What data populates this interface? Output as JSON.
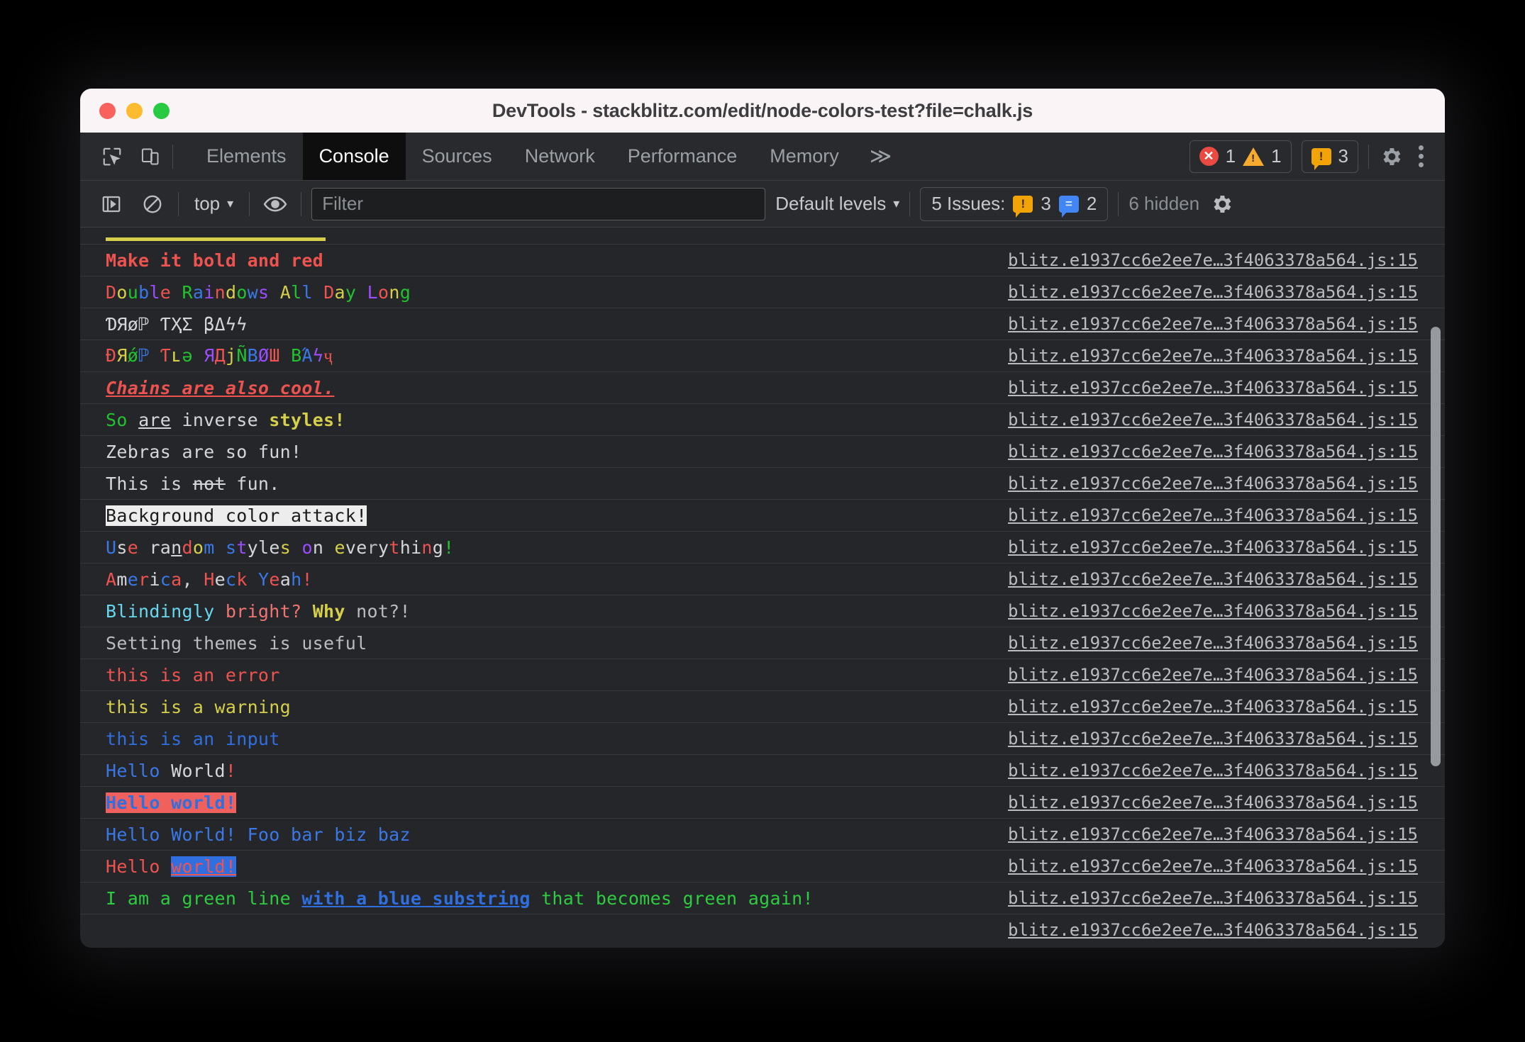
{
  "window": {
    "title": "DevTools - stackblitz.com/edit/node-colors-test?file=chalk.js",
    "traffic_lights": [
      "close-button",
      "minimize-button",
      "maximize-button"
    ]
  },
  "tabbar": {
    "inspect_icon": "inspect-element-icon",
    "device_icon": "device-toolbar-icon",
    "tabs": [
      {
        "label": "Elements",
        "active": false
      },
      {
        "label": "Console",
        "active": true
      },
      {
        "label": "Sources",
        "active": false
      },
      {
        "label": "Network",
        "active": false
      },
      {
        "label": "Performance",
        "active": false
      },
      {
        "label": "Memory",
        "active": false
      }
    ],
    "more_tabs_label": "≫",
    "error_count": "1",
    "warning_count": "1",
    "issue_count": "3",
    "issue_glyph": "!",
    "settings_icon": "gear-icon",
    "menu_icon": "kebab-menu-icon"
  },
  "console_toolbar": {
    "sidebar_icon": "console-sidebar-icon",
    "clear_icon": "clear-console-icon",
    "context": "top",
    "context_caret": "▾",
    "eye_icon": "live-expression-icon",
    "filter_placeholder": "Filter",
    "filter_value": "",
    "levels_label": "Default levels",
    "levels_caret": "▾",
    "issues_label": "5 Issues:",
    "issues_warning_count": "3",
    "issues_info_count": "2",
    "hidden_label": "6 hidden",
    "settings_icon": "console-settings-icon"
  },
  "colors": {
    "red": "#ef5350",
    "salmon": "#f07571",
    "yellow": "#d6cf4a",
    "green": "#22c32e",
    "bright_green": "#2ecc40",
    "blue": "#3b78e7",
    "bright_blue": "#2f6fe0",
    "magenta": "#9b4dff",
    "cyan": "#67d8ef",
    "white": "#d4d6d9",
    "grey": "#b9bcc0",
    "bg_white": "#ededed",
    "bg_red": "#f0605c",
    "bg_blue": "#2f6fe0"
  },
  "source_link": "blitz.e1937cc6e2ee7e…3f4063378a564.js:15",
  "messages": [
    {
      "name": "message-make-it-bold-and-red",
      "text": "Make it bold and red",
      "runs": [
        {
          "t": "Make it bold and red",
          "c": "#ef5350",
          "cls": "b"
        }
      ]
    },
    {
      "name": "message-double-raindows",
      "text": "Double Raindows All Day Long",
      "runs": [
        {
          "t": "D",
          "c": "#ef5350"
        },
        {
          "t": "o",
          "c": "#d6cf4a"
        },
        {
          "t": "u",
          "c": "#22c32e"
        },
        {
          "t": "b",
          "c": "#3b78e7"
        },
        {
          "t": "l",
          "c": "#9b4dff"
        },
        {
          "t": "e",
          "c": "#ef5350"
        },
        {
          "t": " ",
          "c": "#d4d6d9"
        },
        {
          "t": "R",
          "c": "#22c32e"
        },
        {
          "t": "a",
          "c": "#3b78e7"
        },
        {
          "t": "i",
          "c": "#9b4dff"
        },
        {
          "t": "n",
          "c": "#ef5350"
        },
        {
          "t": "d",
          "c": "#d6cf4a"
        },
        {
          "t": "o",
          "c": "#22c32e"
        },
        {
          "t": "w",
          "c": "#3b78e7"
        },
        {
          "t": "s",
          "c": "#9b4dff"
        },
        {
          "t": " ",
          "c": "#d4d6d9"
        },
        {
          "t": "A",
          "c": "#d6cf4a"
        },
        {
          "t": "l",
          "c": "#22c32e"
        },
        {
          "t": "l",
          "c": "#3b78e7"
        },
        {
          "t": " ",
          "c": "#d4d6d9"
        },
        {
          "t": "D",
          "c": "#ef5350"
        },
        {
          "t": "a",
          "c": "#d6cf4a"
        },
        {
          "t": "y",
          "c": "#22c32e"
        },
        {
          "t": " ",
          "c": "#d4d6d9"
        },
        {
          "t": "L",
          "c": "#9b4dff"
        },
        {
          "t": "o",
          "c": "#ef5350"
        },
        {
          "t": "n",
          "c": "#d6cf4a"
        },
        {
          "t": "g",
          "c": "#22c32e"
        }
      ]
    },
    {
      "name": "message-drop-the-bass",
      "text": "ƊЯøℙ ƬҲΣ βΔϟϟ",
      "runs": [
        {
          "t": "ƊЯøℙ ƬҲΣ βΔϟϟ",
          "c": "#d4d6d9"
        }
      ]
    },
    {
      "name": "message-drop-the-rainbow-bass",
      "text": "ÐЯǿℙ Ƭʟə ЯДјÑΒØШ ΒΆϟҷ",
      "runs": [
        {
          "t": "Ð",
          "c": "#ef5350"
        },
        {
          "t": "Я",
          "c": "#d6cf4a"
        },
        {
          "t": "ǿ",
          "c": "#22c32e"
        },
        {
          "t": "ℙ",
          "c": "#3b78e7"
        },
        {
          "t": " ",
          "c": "#d4d6d9"
        },
        {
          "t": "Ƭ",
          "c": "#ef5350"
        },
        {
          "t": "ʟ",
          "c": "#d6cf4a"
        },
        {
          "t": "ə",
          "c": "#22c32e"
        },
        {
          "t": " ",
          "c": "#d4d6d9"
        },
        {
          "t": "Я",
          "c": "#9b4dff"
        },
        {
          "t": "Д",
          "c": "#ef5350"
        },
        {
          "t": "ј",
          "c": "#d6cf4a"
        },
        {
          "t": "Ñ",
          "c": "#22c32e"
        },
        {
          "t": "Β",
          "c": "#3b78e7"
        },
        {
          "t": "Ø",
          "c": "#9b4dff"
        },
        {
          "t": "Ш",
          "c": "#ef5350"
        },
        {
          "t": " ",
          "c": "#d4d6d9"
        },
        {
          "t": "Β",
          "c": "#22c32e"
        },
        {
          "t": "Ά",
          "c": "#3b78e7"
        },
        {
          "t": "ϟ",
          "c": "#9b4dff"
        },
        {
          "t": "ҷ",
          "c": "#ef5350"
        }
      ]
    },
    {
      "name": "message-chains-are-also-cool",
      "text": "Chains are also cool.",
      "runs": [
        {
          "t": "Chains are also cool.",
          "c": "#ef5350",
          "cls": "biu"
        }
      ]
    },
    {
      "name": "message-so-are-inverse-styles",
      "text": "So are inverse styles!",
      "runs": [
        {
          "t": "So",
          "c": "#22c32e"
        },
        {
          "t": " ",
          "c": "#d4d6d9"
        },
        {
          "t": "are",
          "c": "#d4d6d9",
          "cls": "u"
        },
        {
          "t": " inverse ",
          "c": "#d4d6d9"
        },
        {
          "t": "styles!",
          "c": "#d6cf4a",
          "cls": "b"
        }
      ]
    },
    {
      "name": "message-zebras-are-so-fun",
      "text": "Zebras are so fun!",
      "runs": [
        {
          "t": "Zebras are so fun!",
          "c": "#d4d6d9"
        }
      ]
    },
    {
      "name": "message-this-is-not-fun",
      "text": "This is not fun.",
      "runs": [
        {
          "t": "This is ",
          "c": "#d4d6d9"
        },
        {
          "t": "not",
          "c": "#d4d6d9",
          "cls": "s"
        },
        {
          "t": " fun.",
          "c": "#d4d6d9"
        }
      ]
    },
    {
      "name": "message-background-color-attack",
      "text": "Background color attack!",
      "runs": [
        {
          "t": "Background color attack!",
          "c": "#1b1b1b",
          "bg": "#ededed"
        }
      ]
    },
    {
      "name": "message-use-random-styles",
      "text": "Use random styles on everything!",
      "runs": [
        {
          "t": "U",
          "c": "#3b78e7"
        },
        {
          "t": "s",
          "c": "#d4d6d9"
        },
        {
          "t": "e",
          "c": "#ef5350"
        },
        {
          "t": " ",
          "c": "#d4d6d9"
        },
        {
          "t": "r",
          "c": "#d4d6d9"
        },
        {
          "t": "a",
          "c": "#d4d6d9"
        },
        {
          "t": "n",
          "c": "#d4d6d9",
          "cls": "u"
        },
        {
          "t": "d",
          "c": "#ef5350"
        },
        {
          "t": "o",
          "c": "#d6cf4a"
        },
        {
          "t": "m",
          "c": "#3b78e7"
        },
        {
          "t": " ",
          "c": "#d4d6d9"
        },
        {
          "t": "s",
          "c": "#3b78e7"
        },
        {
          "t": "t",
          "c": "#9b4dff"
        },
        {
          "t": "y",
          "c": "#d4d6d9"
        },
        {
          "t": "l",
          "c": "#d4d6d9"
        },
        {
          "t": "e",
          "c": "#d4d6d9"
        },
        {
          "t": "s",
          "c": "#d6cf4a"
        },
        {
          "t": " ",
          "c": "#d4d6d9"
        },
        {
          "t": "o",
          "c": "#9b4dff"
        },
        {
          "t": "n",
          "c": "#d4d6d9"
        },
        {
          "t": " ",
          "c": "#d4d6d9"
        },
        {
          "t": "e",
          "c": "#d6cf4a"
        },
        {
          "t": "v",
          "c": "#d4d6d9"
        },
        {
          "t": "e",
          "c": "#d4d6d9"
        },
        {
          "t": "r",
          "c": "#b9bcc0"
        },
        {
          "t": "y",
          "c": "#d4d6d9"
        },
        {
          "t": "t",
          "c": "#ef5350"
        },
        {
          "t": "h",
          "c": "#d4d6d9"
        },
        {
          "t": "i",
          "c": "#d4d6d9"
        },
        {
          "t": "n",
          "c": "#ef5350"
        },
        {
          "t": "g",
          "c": "#d4d6d9"
        },
        {
          "t": "!",
          "c": "#22c32e"
        }
      ]
    },
    {
      "name": "message-america-heck-yeah",
      "text": "America, Heck Yeah!",
      "runs": [
        {
          "t": "A",
          "c": "#ef5350"
        },
        {
          "t": "m",
          "c": "#d4d6d9"
        },
        {
          "t": "e",
          "c": "#3b78e7"
        },
        {
          "t": "r",
          "c": "#ef5350"
        },
        {
          "t": "i",
          "c": "#d4d6d9"
        },
        {
          "t": "c",
          "c": "#3b78e7"
        },
        {
          "t": "a",
          "c": "#ef5350"
        },
        {
          "t": ",",
          "c": "#d4d6d9"
        },
        {
          "t": " ",
          "c": "#d4d6d9"
        },
        {
          "t": "H",
          "c": "#ef5350"
        },
        {
          "t": "e",
          "c": "#d4d6d9"
        },
        {
          "t": "c",
          "c": "#3b78e7"
        },
        {
          "t": "k",
          "c": "#ef5350"
        },
        {
          "t": " ",
          "c": "#d4d6d9"
        },
        {
          "t": "Y",
          "c": "#3b78e7"
        },
        {
          "t": "e",
          "c": "#ef5350"
        },
        {
          "t": "a",
          "c": "#d4d6d9"
        },
        {
          "t": "h",
          "c": "#3b78e7"
        },
        {
          "t": "!",
          "c": "#ef5350"
        }
      ]
    },
    {
      "name": "message-blindingly-bright",
      "text": "Blindingly bright? Why not?!",
      "runs": [
        {
          "t": "Blindingly",
          "c": "#67d8ef"
        },
        {
          "t": " ",
          "c": "#d4d6d9"
        },
        {
          "t": "bright?",
          "c": "#f07571"
        },
        {
          "t": " ",
          "c": "#d4d6d9"
        },
        {
          "t": "Why",
          "c": "#d6cf4a",
          "cls": "b"
        },
        {
          "t": " ",
          "c": "#d4d6d9"
        },
        {
          "t": "not?!",
          "c": "#b9bcc0"
        }
      ]
    },
    {
      "name": "message-setting-themes",
      "text": "Setting themes is useful",
      "runs": [
        {
          "t": "Setting themes is useful",
          "c": "#b9bcc0"
        }
      ]
    },
    {
      "name": "message-this-is-an-error",
      "text": "this is an error",
      "runs": [
        {
          "t": "this is an error",
          "c": "#ef5350"
        }
      ]
    },
    {
      "name": "message-this-is-a-warning",
      "text": "this is a warning",
      "runs": [
        {
          "t": "this is a warning",
          "c": "#d6cf4a"
        }
      ]
    },
    {
      "name": "message-this-is-an-input",
      "text": "this is an input",
      "runs": [
        {
          "t": "this is an input",
          "c": "#2f6fe0"
        }
      ]
    },
    {
      "name": "message-hello-world-blue",
      "text": "Hello World!",
      "runs": [
        {
          "t": "Hello",
          "c": "#3b78e7"
        },
        {
          "t": " ",
          "c": "#d4d6d9"
        },
        {
          "t": "World",
          "c": "#d4d6d9"
        },
        {
          "t": "!",
          "c": "#ef5350"
        }
      ]
    },
    {
      "name": "message-hello-world-red-bg",
      "text": "Hello world!",
      "runs": [
        {
          "t": "Hello world!",
          "c": "#2f6fe0",
          "bg": "#f0605c",
          "cls": "b"
        }
      ]
    },
    {
      "name": "message-hello-world-foo-bar",
      "text": "Hello World! Foo bar biz baz",
      "runs": [
        {
          "t": "Hello World! Foo bar biz baz",
          "c": "#3b78e7"
        }
      ]
    },
    {
      "name": "message-hello-world-blue-bg",
      "text": "Hello world!",
      "runs": [
        {
          "t": "Hello",
          "c": "#ef5350"
        },
        {
          "t": " ",
          "c": "#d4d6d9"
        },
        {
          "t": "world!",
          "c": "#ef5350",
          "bg": "#2f6fe0",
          "cls": "u"
        }
      ]
    },
    {
      "name": "message-green-line-blue-substring",
      "text": "I am a green line with a blue substring that becomes green again!",
      "runs": [
        {
          "t": "I am a green line ",
          "c": "#2ecc40"
        },
        {
          "t": "with a blue substring",
          "c": "#2f6fe0",
          "cls": "bu"
        },
        {
          "t": " that becomes green again!",
          "c": "#2ecc40"
        }
      ]
    }
  ],
  "trailing_source_link": "blitz.e1937cc6e2ee7e…3f4063378a564.js:15"
}
